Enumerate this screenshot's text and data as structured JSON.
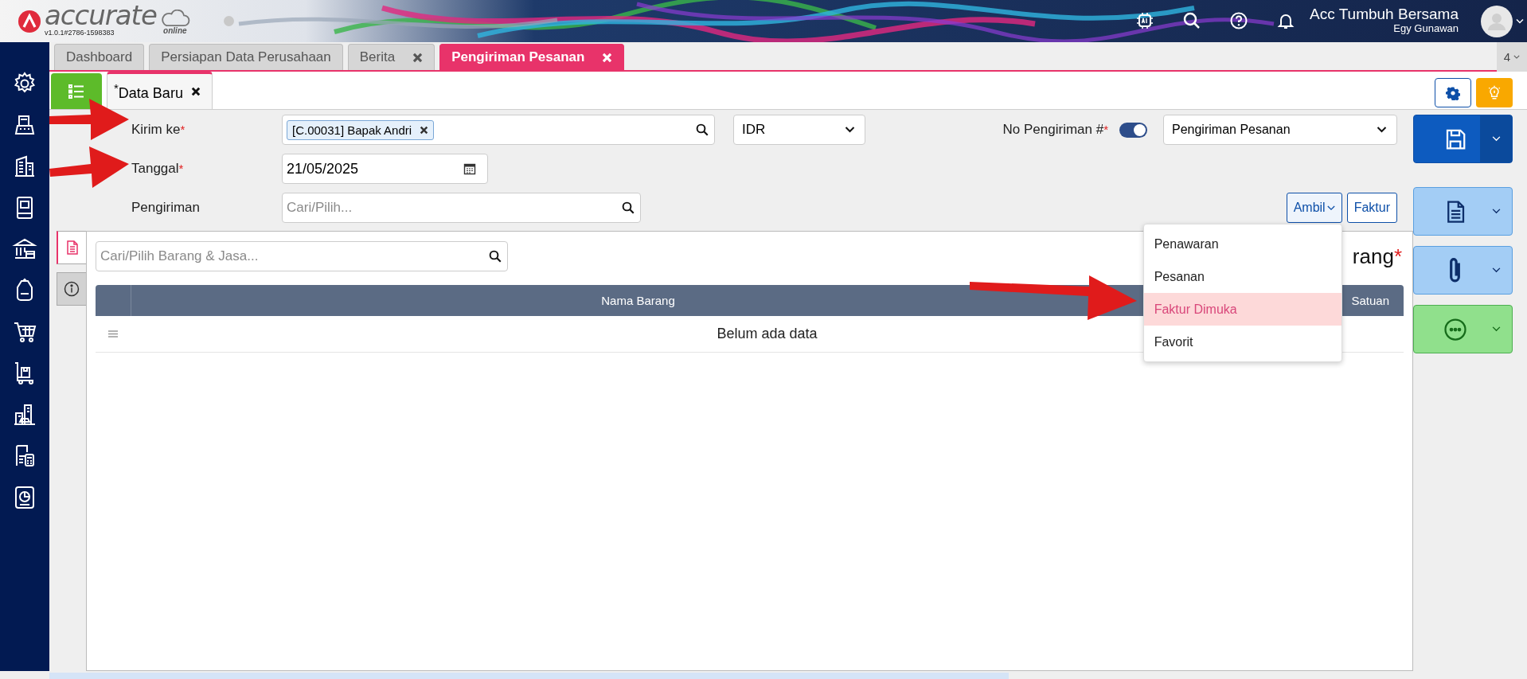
{
  "header": {
    "logo": "accurate",
    "logo_sub": "online",
    "version": "v1.0.1#2786-1598383",
    "company": "Acc Tumbuh Bersama",
    "user": "Egy Gunawan"
  },
  "sidebar": {
    "items": [
      {
        "kind": "gear"
      },
      {
        "kind": "register"
      },
      {
        "kind": "building"
      },
      {
        "kind": "book"
      },
      {
        "kind": "bank"
      },
      {
        "kind": "tag"
      },
      {
        "kind": "cart"
      },
      {
        "kind": "trolley"
      },
      {
        "kind": "city"
      },
      {
        "kind": "calculator"
      },
      {
        "kind": "report"
      }
    ]
  },
  "tabs": [
    {
      "label": "Dashboard",
      "closable": false,
      "selected": false
    },
    {
      "label": "Persiapan Data Perusahaan",
      "closable": false,
      "selected": false
    },
    {
      "label": "Berita",
      "closable": true,
      "selected": false
    },
    {
      "label": "Pengiriman Pesanan",
      "closable": true,
      "selected": true
    }
  ],
  "tab_count": "4",
  "subtabs": [
    {
      "label": "$^{*}$Data Baru",
      "closable": true,
      "selected": true
    }
  ],
  "form": {
    "fields": [
      {
        "label": "Kirim ke",
        "required_mark": "*",
        "kind": "chip-search",
        "chip": "[C.00031] Bapak Andri"
      },
      {
        "label": "Tanggal",
        "required_mark": "*",
        "kind": "date",
        "value": "21/05/2025"
      },
      {
        "label": "Pengiriman",
        "kind": "search",
        "placeholder": "Cari/Pilih..."
      }
    ],
    "currency": "IDR",
    "number_label": "No Pengiriman #",
    "number_required_mark": "*",
    "auto_number": true,
    "number_type": "Pengiriman Pesanan"
  },
  "toolbar_buttons": [
    {
      "label": "Ambil",
      "kind": "dropdown",
      "expanded": true
    },
    {
      "label": "Faktur",
      "kind": "plain"
    }
  ],
  "dropdown": {
    "items": [
      {
        "label": "Penawaran",
        "selected": false
      },
      {
        "label": "Pesanan",
        "selected": false
      },
      {
        "label": "Faktur Dimuka",
        "selected": true
      },
      {
        "label": "Favorit",
        "selected": false
      }
    ]
  },
  "panel": {
    "side_tabs": [
      {
        "kind": "document",
        "selected": true
      },
      {
        "kind": "info",
        "selected": false
      }
    ],
    "search_placeholder": "Cari/Pilih Barang & Jasa...",
    "title": "rang",
    "title_mark": "*",
    "table": {
      "columns": [
        "Nama Barang",
        "Satuan"
      ],
      "empty_text": "Belum ada data"
    }
  },
  "actions": [
    {
      "kind": "save"
    },
    {
      "kind": "document"
    },
    {
      "kind": "attach"
    },
    {
      "kind": "more"
    }
  ]
}
